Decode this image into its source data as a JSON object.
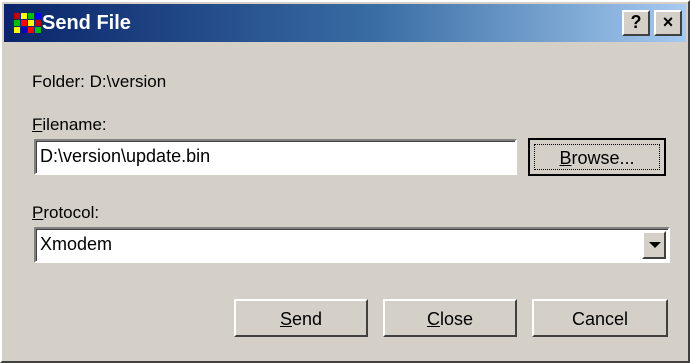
{
  "window": {
    "title": "Send File",
    "help_glyph": "?",
    "close_glyph": "×"
  },
  "folder": {
    "label": "Folder:",
    "path": "D:\\version"
  },
  "filename": {
    "label_mnemonic": "F",
    "label_rest": "ilename:",
    "value": "D:\\version\\update.bin"
  },
  "browse_button": {
    "mnemonic": "B",
    "rest": "rowse..."
  },
  "protocol": {
    "label_mnemonic": "P",
    "label_rest": "rotocol:",
    "selected": "Xmodem"
  },
  "buttons": {
    "send": {
      "mnemonic": "S",
      "rest": "end"
    },
    "close": {
      "mnemonic": "C",
      "rest": "lose"
    },
    "cancel": {
      "label": "Cancel"
    }
  },
  "colors": {
    "face": "#d4d0c8",
    "titlebar_start": "#0a246a",
    "titlebar_end": "#a6caf0"
  },
  "icons": {
    "app": "send-file-app-icon",
    "help": "help-icon",
    "close": "close-icon",
    "dropdown": "chevron-down-icon"
  }
}
